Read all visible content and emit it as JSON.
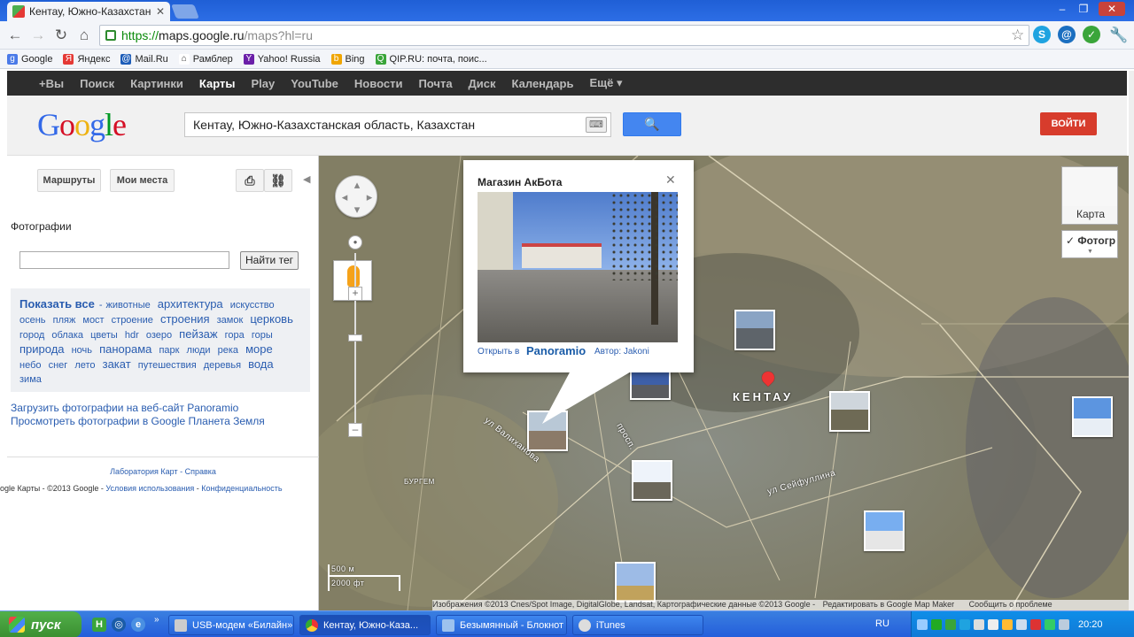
{
  "browser": {
    "tab_title": "Кентау, Южно-Казахстанск...",
    "tab_close": "✕",
    "window_buttons": [
      "–",
      "❐",
      "✕"
    ],
    "url_https": "https://",
    "url_host": "maps.google.ru",
    "url_path": "/maps?hl=ru",
    "bookmarks": [
      {
        "label": "Google",
        "icon": "google-g-icon",
        "color": "#4a7ae8"
      },
      {
        "label": "Яндекс",
        "icon": "yandex-icon",
        "color": "#e53935"
      },
      {
        "label": "Mail.Ru",
        "icon": "mailru-icon",
        "color": "#1c5cb8"
      },
      {
        "label": "Рамблер",
        "icon": "home-icon",
        "color": "#333333"
      },
      {
        "label": "Yahoo! Russia",
        "icon": "yahoo-icon",
        "color": "#6b1fa8"
      },
      {
        "label": "Bing",
        "icon": "bing-icon",
        "color": "#f0a500"
      },
      {
        "label": "QIP.RU: почта, поис...",
        "icon": "qip-icon",
        "color": "#3aa53a"
      }
    ]
  },
  "gbar": {
    "items": [
      "+Вы",
      "Поиск",
      "Картинки",
      "Карты",
      "Play",
      "YouTube",
      "Новости",
      "Почта",
      "Диск",
      "Календарь",
      "Ещё ▾"
    ],
    "active_index": 3
  },
  "header": {
    "logo": "Google",
    "search_value": "Кентау, Южно-Казахстанская область, Казахстан",
    "login": "ВОЙТИ"
  },
  "panel": {
    "routes": "Маршруты",
    "myplaces": "Мои места",
    "title": "Фотографии",
    "tag_button": "Найти тег",
    "show_all": "Показать все",
    "tags": [
      {
        "t": "животные",
        "s": 0
      },
      {
        "t": "архитектура",
        "s": 1
      },
      {
        "t": "искусство",
        "s": 0
      },
      {
        "t": "осень",
        "s": 0
      },
      {
        "t": "пляж",
        "s": 0
      },
      {
        "t": "мост",
        "s": 0
      },
      {
        "t": "строение",
        "s": 0
      },
      {
        "t": "строения",
        "s": 1
      },
      {
        "t": "замок",
        "s": 0
      },
      {
        "t": "церковь",
        "s": 1
      },
      {
        "t": "город",
        "s": 0
      },
      {
        "t": "облака",
        "s": 0
      },
      {
        "t": "цветы",
        "s": 0
      },
      {
        "t": "hdr",
        "s": 0
      },
      {
        "t": "озеро",
        "s": 0
      },
      {
        "t": "пейзаж",
        "s": 1
      },
      {
        "t": "гора",
        "s": 0
      },
      {
        "t": "горы",
        "s": 0
      },
      {
        "t": "природа",
        "s": 1
      },
      {
        "t": "ночь",
        "s": 0
      },
      {
        "t": "панорама",
        "s": 1
      },
      {
        "t": "парк",
        "s": 0
      },
      {
        "t": "люди",
        "s": 0
      },
      {
        "t": "река",
        "s": 0
      },
      {
        "t": "море",
        "s": 1
      },
      {
        "t": "небо",
        "s": 0
      },
      {
        "t": "снег",
        "s": 0
      },
      {
        "t": "лето",
        "s": 0
      },
      {
        "t": "закат",
        "s": 1
      },
      {
        "t": "путешествия",
        "s": 0
      },
      {
        "t": "деревья",
        "s": 0
      },
      {
        "t": "вода",
        "s": 1
      },
      {
        "t": "зима",
        "s": 0
      }
    ],
    "link1": "Загрузить фотографии на веб-сайт Panoramio",
    "link2": "Просмотреть фотографии в Google Планета Земля",
    "labs": "Лаборатория Карт",
    "help": "Справка",
    "copyright": "ogle Карты - ©2013 Google -",
    "terms": "Условия использования",
    "privacy": "Конфиденциальность"
  },
  "map": {
    "city_label": "КЕНТАУ",
    "street1": "ул Сейфуллина",
    "street2": "ул Валиханова",
    "street3": "просп.",
    "district": "БУРГЕМ",
    "map_type": "Карта",
    "photo_type": "✓ Фотогр",
    "scale_m": "500 м",
    "scale_ft": "2000 фт",
    "attribution": "Изображения ©2013 Cnes/Spot Image, DigitalGlobe, Landsat, Картографические данные ©2013 Google -",
    "edit_link": "Редактировать в Google Map Maker",
    "report": "Сообщить о проблеме",
    "info": {
      "title": "Магазин АкБота",
      "open": "Открыть в",
      "brand": "Panoramio",
      "author": "Автор: Jakoni"
    }
  },
  "taskbar": {
    "start": "пуск",
    "tasks": [
      "USB-модем «Билайн»",
      "Кентау, Южно-Каза...",
      "Безымянный - Блокнот",
      "iTunes"
    ],
    "lang": "RU",
    "clock": "20:20"
  }
}
